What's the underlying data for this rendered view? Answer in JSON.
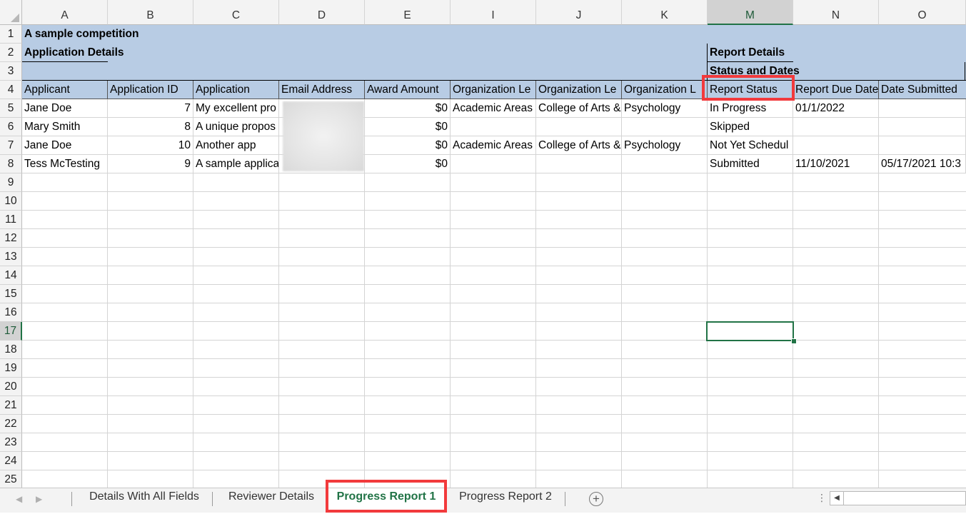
{
  "columns": [
    {
      "letter": "A",
      "header": "Applicant"
    },
    {
      "letter": "B",
      "header": "Application ID"
    },
    {
      "letter": "C",
      "header": "Application"
    },
    {
      "letter": "D",
      "header": "Email Address"
    },
    {
      "letter": "E",
      "header": "Award Amount"
    },
    {
      "letter": "I",
      "header": "Organization Le"
    },
    {
      "letter": "J",
      "header": "Organization Le"
    },
    {
      "letter": "K",
      "header": "Organization L"
    },
    {
      "letter": "M",
      "header": "Report Status"
    },
    {
      "letter": "N",
      "header": "Report Due Date"
    },
    {
      "letter": "O",
      "header": "Date Submitted"
    }
  ],
  "row_numbers": [
    "1",
    "2",
    "3",
    "4",
    "5",
    "6",
    "7",
    "8",
    "9",
    "10",
    "11",
    "12",
    "13",
    "14",
    "15",
    "16",
    "17",
    "18",
    "19",
    "20",
    "21",
    "22",
    "23",
    "24",
    "25"
  ],
  "sheet": {
    "title": "A sample competition",
    "application_details": "Application Details",
    "report_details": "Report Details",
    "status_and_dates": "Status and Dates"
  },
  "rows": [
    {
      "applicant": "Jane Doe",
      "app_id": "7",
      "application": "My excellent pro",
      "email": "",
      "award": "$0",
      "org1": "Academic Areas",
      "org2": "College of Arts &",
      "org3": "Psychology",
      "status": "In Progress",
      "due": "01/1/2022",
      "submitted": ""
    },
    {
      "applicant": "Mary Smith",
      "app_id": "8",
      "application": "A unique propos",
      "email": "",
      "award": "$0",
      "org1": "",
      "org2": "",
      "org3": "",
      "status": "Skipped",
      "due": "",
      "submitted": ""
    },
    {
      "applicant": "Jane Doe",
      "app_id": "10",
      "application": "Another app",
      "email": "",
      "award": "$0",
      "org1": "Academic Areas",
      "org2": "College of Arts &",
      "org3": "Psychology",
      "status": "Not Yet Schedul",
      "due": "",
      "submitted": ""
    },
    {
      "applicant": "Tess McTesting",
      "app_id": "9",
      "application": "A sample applica",
      "email": "",
      "award": "$0",
      "org1": "",
      "org2": "",
      "org3": "",
      "status": "Submitted",
      "due": "11/10/2021",
      "submitted": "05/17/2021 10:3"
    }
  ],
  "selected_cell": {
    "column": "M",
    "row": "17"
  },
  "tabs": [
    {
      "label": "Details With All Fields",
      "active": false
    },
    {
      "label": "Reviewer Details",
      "active": false
    },
    {
      "label": "Progress Report 1",
      "active": true
    },
    {
      "label": "Progress Report 2",
      "active": false
    }
  ],
  "tab_nav": {
    "prev_icon": "triangle-left",
    "next_icon": "triangle-right",
    "add_icon": "plus-circle"
  },
  "colors": {
    "header_band": "#b8cce4",
    "accent": "#217346",
    "highlight": "#f23a3c"
  }
}
